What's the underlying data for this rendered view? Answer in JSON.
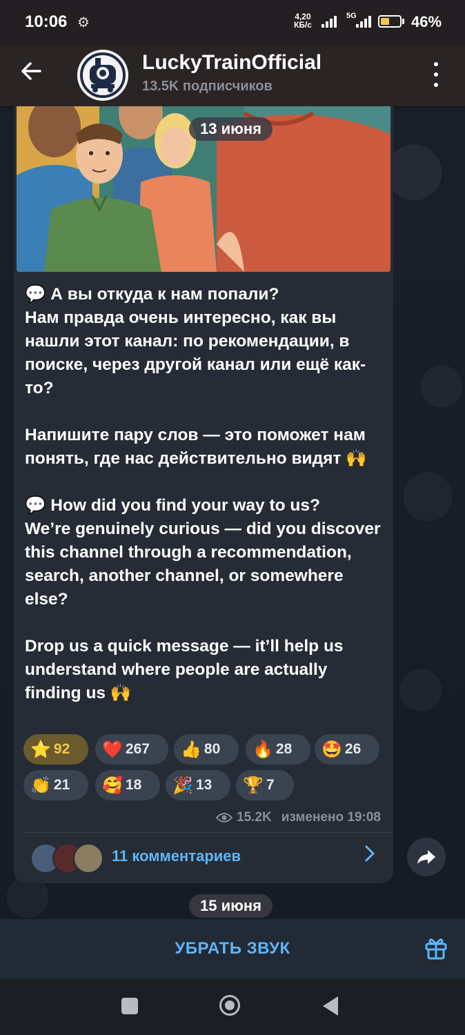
{
  "status_bar": {
    "time": "10:06",
    "speed_value": "4,20",
    "speed_unit": "КБ/с",
    "network": "5G",
    "battery": "46%",
    "battery_level": 0.46
  },
  "header": {
    "title": "LuckyTrainOfficial",
    "subscribers": "13.5K подписчиков"
  },
  "post": {
    "date_top": "13 июня",
    "text": "💬 А вы откуда к нам попали?\nНам правда очень интересно, как вы нашли этот канал: по рекомендации, в поиске, через другой канал или ещё как-то?\n\nНапишите пару слов — это поможет нам понять, где нас действительно видят 🙌\n\n💬 How did you find your way to us?\nWe’re genuinely curious — did you discover this channel through a recommendation, search, another channel, or somewhere else?\n\nDrop us a quick message — it’ll help us understand where people are actually finding us 🙌",
    "reactions": [
      {
        "emoji": "⭐",
        "count": "92",
        "active": true
      },
      {
        "emoji": "❤️",
        "count": "267"
      },
      {
        "emoji": "👍",
        "count": "80"
      },
      {
        "emoji": "🔥",
        "count": "28"
      },
      {
        "emoji": "🤩",
        "count": "26"
      },
      {
        "emoji": "👏",
        "count": "21"
      },
      {
        "emoji": "🥰",
        "count": "18"
      },
      {
        "emoji": "🎉",
        "count": "13"
      },
      {
        "emoji": "🏆",
        "count": "7"
      }
    ],
    "views": "15.2K",
    "edited": "изменено 19:08",
    "comments": "11 комментариев"
  },
  "date_bottom": "15 июня",
  "bottom": {
    "mute_label": "УБРАТЬ ЗВУК"
  },
  "colors": {
    "accent": "#5eb5f7",
    "bubble": "#262c36",
    "star_reaction": "#f2c94c"
  }
}
